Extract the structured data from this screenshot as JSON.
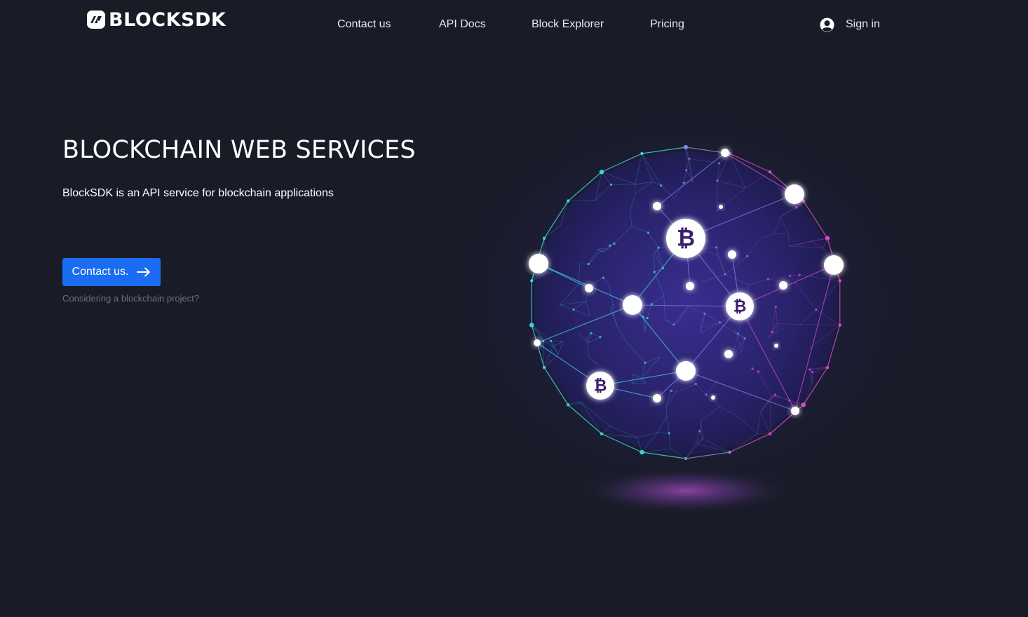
{
  "header": {
    "logo_text": "BLOCKSDK",
    "logo_icon": "blocksdk-logo-mark",
    "nav": [
      {
        "label": "Contact us"
      },
      {
        "label": "API Docs"
      },
      {
        "label": "Block Explorer"
      },
      {
        "label": "Pricing"
      }
    ],
    "sign_in": {
      "label": "Sign in",
      "icon": "user-icon"
    }
  },
  "hero": {
    "title": "BLOCKCHAIN WEB SERVICES",
    "subtitle": "BlockSDK is an API service for blockchain applications",
    "cta_label": "Contact us.",
    "cta_icon": "arrow-right-icon",
    "cta_note": "Considering a blockchain project?"
  },
  "illustration": {
    "description_icon": "blockchain-network-globe",
    "coin_symbol": "₿"
  },
  "colors": {
    "background": "#191c27",
    "primary_button": "#1a6cf0",
    "network_cyan": "#3fd0e0",
    "network_magenta": "#d04ad8",
    "globe_core": "#2a2370",
    "text_muted": "#6c7080"
  }
}
